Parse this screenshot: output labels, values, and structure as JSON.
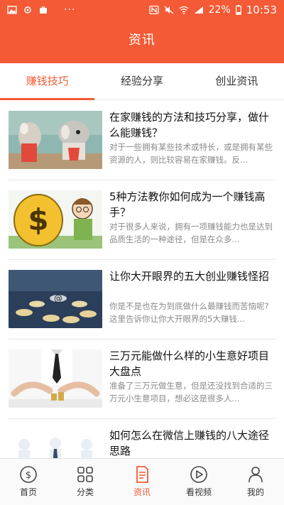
{
  "status_bar": {
    "left_icons": [
      "image-icon",
      "cloud-icon",
      "shopping-bag-icon",
      "more-dots-icon"
    ],
    "right_icons": [
      "nfc-icon",
      "mute-icon",
      "wifi-icon",
      "signal-icon",
      "battery-icon"
    ],
    "battery": "22%",
    "time": "10:53",
    "dots": "···"
  },
  "header": {
    "title": "资讯"
  },
  "tabs": [
    {
      "label": "赚钱技巧",
      "active": true
    },
    {
      "label": "经验分享",
      "active": false
    },
    {
      "label": "创业资讯",
      "active": false
    }
  ],
  "articles": [
    {
      "title": "在家赚钱的方法和技巧分享，做什么能赚钱？",
      "desc": "对于一些拥有某些技术或特长，或是拥有某些资源的人，则比较容易在家赚钱。反..."
    },
    {
      "title": "5种方法教你如何成为一个赚钱高手？",
      "desc": "对于很多人来说，拥有一项赚钱能力也是达到品质生活的一种途径，但是在众多..."
    },
    {
      "title": "让你大开眼界的五大创业赚钱怪招",
      "desc": "你是不是也在为到底做什么最赚钱而苦恼呢?这里告诉你让你大开眼界的5大赚钱..."
    },
    {
      "title": "三万元能做什么样的小生意好项目大盘点",
      "desc": "准备了三万元做生意，但是还没找到合适的三万元小生意项目，想必这是很多人..."
    },
    {
      "title": "如何怎么在微信上赚钱的八大途径思路",
      "desc": ""
    }
  ],
  "bottom_nav": [
    {
      "label": "首页",
      "icon": "dollar-circle-icon",
      "active": false
    },
    {
      "label": "分类",
      "icon": "grid-icon",
      "active": false
    },
    {
      "label": "资讯",
      "icon": "document-icon",
      "active": true
    },
    {
      "label": "看视频",
      "icon": "play-circle-icon",
      "active": false
    },
    {
      "label": "我的",
      "icon": "person-icon",
      "active": false
    }
  ],
  "colors": {
    "accent": "#f35a35",
    "text": "#111111",
    "muted": "#8a8a8a",
    "divider": "#e6e6e6"
  }
}
